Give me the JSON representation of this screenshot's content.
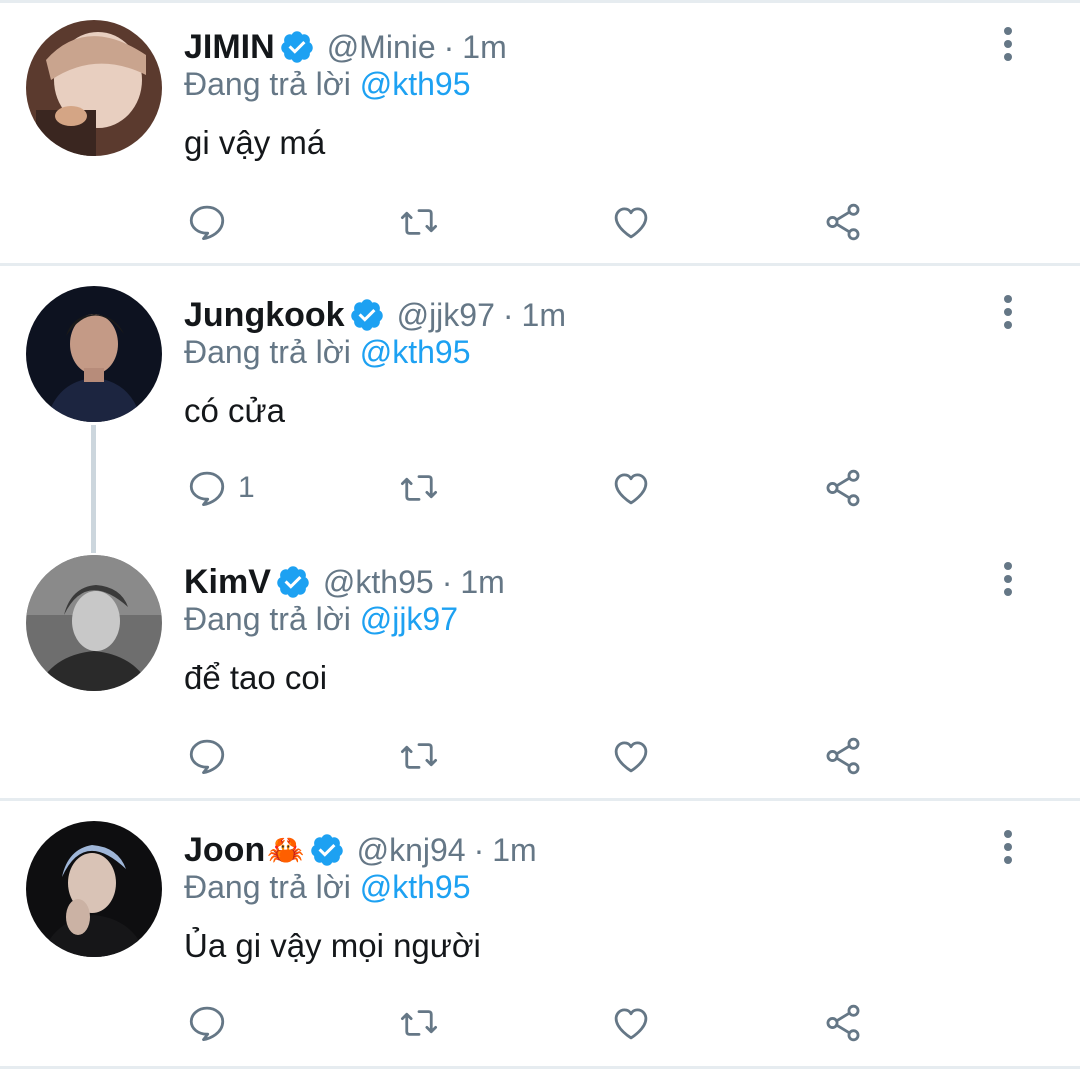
{
  "reply_prefix": "Đang trả lời",
  "tweets": [
    {
      "name": "JIMIN",
      "emoji": "",
      "handle": "@Minie",
      "separator": "·",
      "time": "1m",
      "reply_to": "@kth95",
      "text": "gi vậy má",
      "reply_count": "",
      "avatar_colors": [
        "#c9a48e",
        "#5b3a2e",
        "#e8cfc0"
      ]
    },
    {
      "name": "Jungkook",
      "emoji": "",
      "handle": "@jjk97",
      "separator": "·",
      "time": "1m",
      "reply_to": "@kth95",
      "text": "có cửa",
      "reply_count": "1",
      "avatar_colors": [
        "#1c2540",
        "#0d1220",
        "#c49a86"
      ]
    },
    {
      "name": "KimV",
      "emoji": "",
      "handle": "@kth95",
      "separator": "·",
      "time": "1m",
      "reply_to": "@jjk97",
      "text": "để tao coi",
      "reply_count": "",
      "avatar_colors": [
        "#8a8a8a",
        "#2a2a2a",
        "#c8c8c8"
      ]
    },
    {
      "name": "Joon",
      "emoji": "🦀",
      "handle": "@knj94",
      "separator": "·",
      "time": "1m",
      "reply_to": "@kth95",
      "text": "Ủa gi vậy mọi người",
      "reply_count": "",
      "avatar_colors": [
        "#0e0e10",
        "#9fb6d8",
        "#d9c3b6"
      ]
    }
  ],
  "colors": {
    "accent": "#1da1f2",
    "secondary_text": "#657786",
    "primary_text": "#14171a",
    "icon": "#657786",
    "divider": "#e6ecf0"
  },
  "icons": [
    "reply-icon",
    "retweet-icon",
    "like-icon",
    "share-icon",
    "more-options-icon",
    "verified-badge-icon"
  ]
}
